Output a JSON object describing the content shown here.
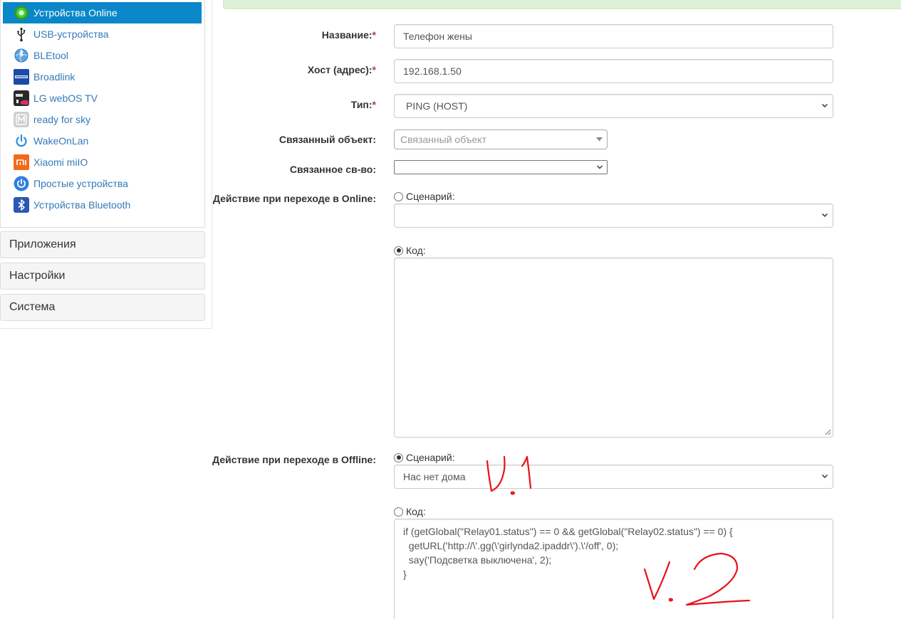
{
  "sidebar": {
    "items": [
      {
        "label": "Устройства Online",
        "icon": "green-circle-icon",
        "active": true
      },
      {
        "label": "USB-устройства",
        "icon": "usb-icon"
      },
      {
        "label": "BLEtool",
        "icon": "bluetooth-globe-icon"
      },
      {
        "label": "Broadlink",
        "icon": "broadlink-icon"
      },
      {
        "label": "LG webOS TV",
        "icon": "lg-tv-icon"
      },
      {
        "label": "ready for sky",
        "icon": "sky-m-icon"
      },
      {
        "label": "WakeOnLan",
        "icon": "power-icon"
      },
      {
        "label": "Xiaomi miIO",
        "icon": "xiaomi-icon"
      },
      {
        "label": "Простые устройства",
        "icon": "power-round-icon"
      },
      {
        "label": "Устройства Bluetooth",
        "icon": "bluetooth-icon"
      }
    ],
    "panels": [
      {
        "label": "Приложения"
      },
      {
        "label": "Настройки"
      },
      {
        "label": "Система"
      }
    ]
  },
  "form": {
    "name": {
      "label": "Название:",
      "required_mark": "*",
      "value": "Телефон жены"
    },
    "host": {
      "label": "Хост (адрес):",
      "required_mark": "*",
      "value": "192.168.1.50"
    },
    "type": {
      "label": "Тип:",
      "required_mark": "*",
      "value": "PING (HOST)"
    },
    "linked_object": {
      "label": "Связанный объект:",
      "placeholder": "Связанный объект"
    },
    "linked_property": {
      "label": "Связанное св-во:",
      "value": ""
    },
    "online_action": {
      "label": "Действие при переходе в Online:",
      "scenario_label": "Сценарий:",
      "scenario_value": "",
      "code_label": "Код:",
      "selected": "code",
      "code": ""
    },
    "offline_action": {
      "label": "Действие при переходе в Offline:",
      "scenario_label": "Сценарий:",
      "scenario_value": "Нас нет дома",
      "code_label": "Код:",
      "selected": "scenario",
      "code": "if (getGlobal(\"Relay01.status\") == 0 && getGlobal(\"Relay02.status\") == 0) {\n  getURL('http://\\'.gg(\\'girlynda2.ipaddr\\').\\'/off', 0);\n  say('Подсветка выключена', 2);\n}"
    }
  },
  "annotations": {
    "first": "V.1",
    "second": "V.2",
    "color": "#e8101a"
  },
  "colors": {
    "active_nav": "#0a87c8",
    "link": "#337ab7",
    "required": "#a94442",
    "success_strip": "#dff0d8"
  }
}
